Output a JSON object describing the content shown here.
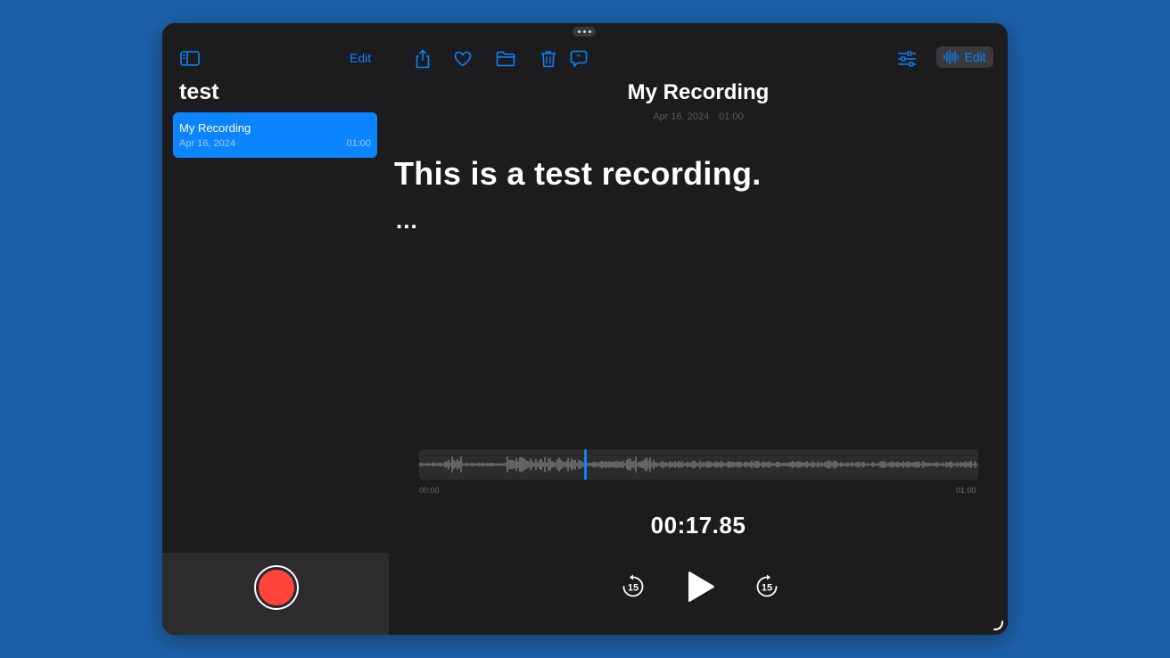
{
  "sidebar": {
    "edit_label": "Edit",
    "folder_title": "test",
    "recordings": [
      {
        "name": "My Recording",
        "date": "Apr 16, 2024",
        "duration": "01:00"
      }
    ]
  },
  "detail": {
    "title": "My Recording",
    "date": "Apr 16, 2024",
    "duration": "01:00",
    "transcript": "This is a test recording.",
    "transcript_more": "...",
    "edit_label": "Edit",
    "waveform": {
      "start_label": "00:00",
      "end_label": "01:00",
      "playhead_fraction": 0.2975
    },
    "elapsed_time": "00:17.85",
    "skip_back_seconds": "15",
    "skip_forward_seconds": "15"
  },
  "icons": {
    "sidebar_toggle": "sidebar-toggle-icon",
    "share": "share-icon",
    "favorite": "heart-icon",
    "folder": "folder-icon",
    "delete": "trash-icon",
    "transcript": "transcript-bubble-icon",
    "options": "sliders-icon",
    "waveform_edit": "waveform-icon",
    "skip_back": "skip-back-15-icon",
    "play": "play-icon",
    "skip_forward": "skip-forward-15-icon"
  },
  "colors": {
    "accent": "#0a84ff",
    "record": "#ff453a",
    "background": "#1c1c1e",
    "desktop": "#1d5fa8"
  }
}
